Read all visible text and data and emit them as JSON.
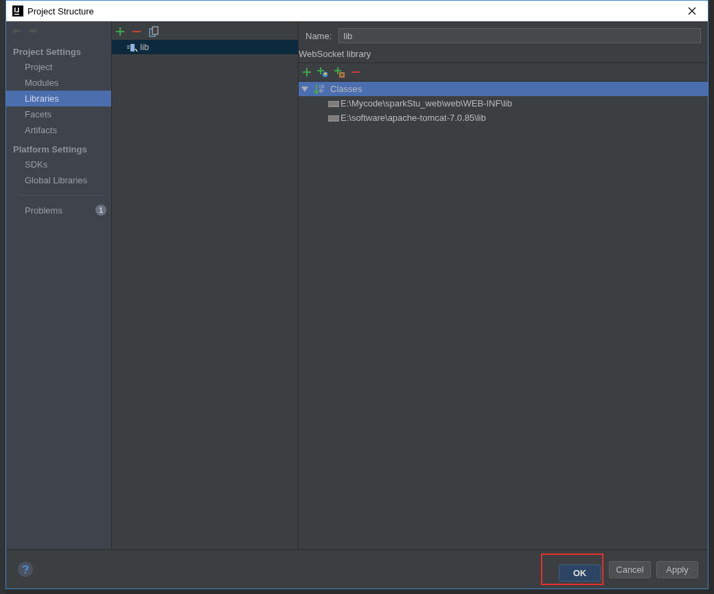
{
  "window": {
    "title": "Project Structure"
  },
  "sidebar": {
    "sections": [
      {
        "heading": "Project Settings",
        "items": [
          {
            "label": "Project",
            "selected": false
          },
          {
            "label": "Modules",
            "selected": false
          },
          {
            "label": "Libraries",
            "selected": true
          },
          {
            "label": "Facets",
            "selected": false
          },
          {
            "label": "Artifacts",
            "selected": false
          }
        ]
      },
      {
        "heading": "Platform Settings",
        "items": [
          {
            "label": "SDKs",
            "selected": false
          },
          {
            "label": "Global Libraries",
            "selected": false
          }
        ]
      }
    ],
    "problems": {
      "label": "Problems",
      "count": "1"
    }
  },
  "libraries": [
    {
      "name": "lib",
      "selected": true
    }
  ],
  "detail": {
    "name_label": "Name:",
    "name_value": "lib",
    "library_title": "WebSocket library",
    "tree": [
      {
        "label": "Classes",
        "expanded": true,
        "selected": true,
        "children": [
          {
            "label": "E:\\Mycode\\sparkStu_web\\web\\WEB-INF\\lib",
            "selected": false
          },
          {
            "label": "E:\\software\\apache-tomcat-7.0.85\\lib",
            "selected": false
          }
        ]
      }
    ]
  },
  "buttons": [
    {
      "label": "OK",
      "kind": "default",
      "highlighted": true
    },
    {
      "label": "Cancel",
      "kind": "normal",
      "highlighted": false
    },
    {
      "label": "Apply",
      "kind": "normal",
      "highlighted": false
    }
  ]
}
